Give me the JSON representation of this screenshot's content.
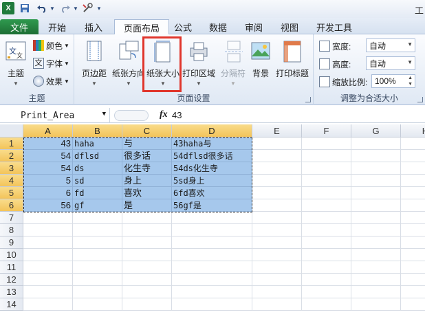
{
  "app": {
    "title_fragment": "工",
    "logo_letter": "X"
  },
  "qat": {
    "undo_icon": "undo-icon",
    "redo_icon": "redo-icon",
    "save_icon": "save-icon",
    "customize_icon": "customize-icon"
  },
  "tabs": [
    "文件",
    "开始",
    "插入",
    "页面布局",
    "公式",
    "数据",
    "审阅",
    "视图",
    "开发工具"
  ],
  "ribbon": {
    "theme_group": {
      "label": "主题",
      "theme_btn": "主题",
      "colors": "颜色",
      "fonts": "字体",
      "effects": "效果"
    },
    "page_setup_group": {
      "label": "页面设置",
      "margins": "页边距",
      "orientation": "纸张方向",
      "size": "纸张大小",
      "print_area": "打印区域",
      "breaks": "分隔符",
      "background": "背景",
      "print_titles": "打印标题"
    },
    "scale_group": {
      "label": "调整为合适大小",
      "width_label": "宽度:",
      "width_value": "自动",
      "height_label": "高度:",
      "height_value": "自动",
      "scale_label": "缩放比例:",
      "scale_value": "100%"
    }
  },
  "formula_bar": {
    "name_box": "Print_Area",
    "fx": "fx",
    "content": "43"
  },
  "columns": [
    "A",
    "B",
    "C",
    "D",
    "E",
    "F",
    "G",
    "H"
  ],
  "rows": [
    "1",
    "2",
    "3",
    "4",
    "5",
    "6",
    "7",
    "8",
    "9",
    "10",
    "11",
    "12",
    "13",
    "14"
  ],
  "cells": [
    [
      "43",
      "haha",
      "与",
      "43haha与"
    ],
    [
      "54",
      "dflsd",
      "很多话",
      "54dflsd很多话"
    ],
    [
      "54",
      "ds",
      "化生寺",
      "54ds化生寺"
    ],
    [
      "5",
      "sd",
      "身上",
      "5sd身上"
    ],
    [
      "6",
      "fd",
      "喜欢",
      "6fd喜欢"
    ],
    [
      "56",
      "gf",
      "是",
      "56gf是"
    ]
  ],
  "colors": {
    "selection": "#a6c8ec",
    "highlight": "#e0352b",
    "file_tab": "#1d6e34",
    "header_selected": "#f3c45a"
  }
}
